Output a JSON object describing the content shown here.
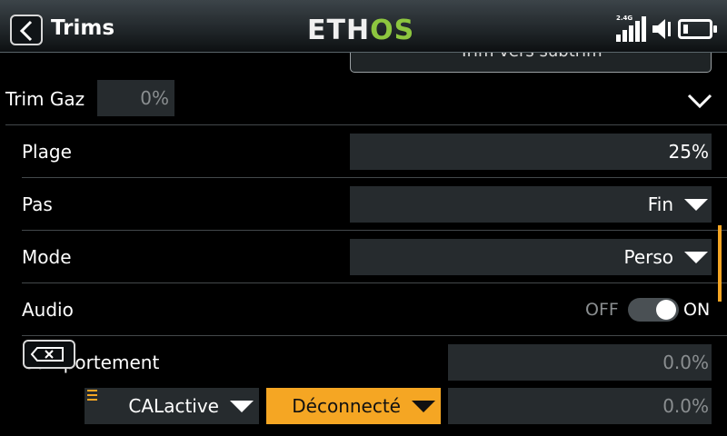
{
  "header": {
    "title": "Trims",
    "logo_main": "ETH",
    "logo_accent": "OS",
    "signal_label": "2.4G",
    "accent_color": "#f5a623",
    "logo_accent_color": "#8dc63f"
  },
  "partial_button": {
    "label": "Trim vers subtrim"
  },
  "trim_gaz": {
    "label": "Trim Gaz",
    "value": "0%"
  },
  "rows": {
    "plage": {
      "label": "Plage",
      "value": "25%"
    },
    "pas": {
      "label": "Pas",
      "value": "Fin"
    },
    "mode": {
      "label": "Mode",
      "value": "Perso"
    },
    "audio": {
      "label": "Audio",
      "off": "OFF",
      "on": "ON",
      "state": true
    },
    "comportement": {
      "label": "Comportement",
      "value": "0.0%"
    }
  },
  "bottom_row": {
    "switch_value": "CALactive",
    "state_value": "Déconnecté",
    "value": "0.0%"
  },
  "icons": {
    "back": "chevron-left-icon",
    "expand": "chevron-down-icon",
    "delete": "backspace-icon",
    "menu": "hamburger-icon",
    "signal": "signal-icon",
    "speaker": "speaker-icon",
    "battery": "battery-icon"
  }
}
